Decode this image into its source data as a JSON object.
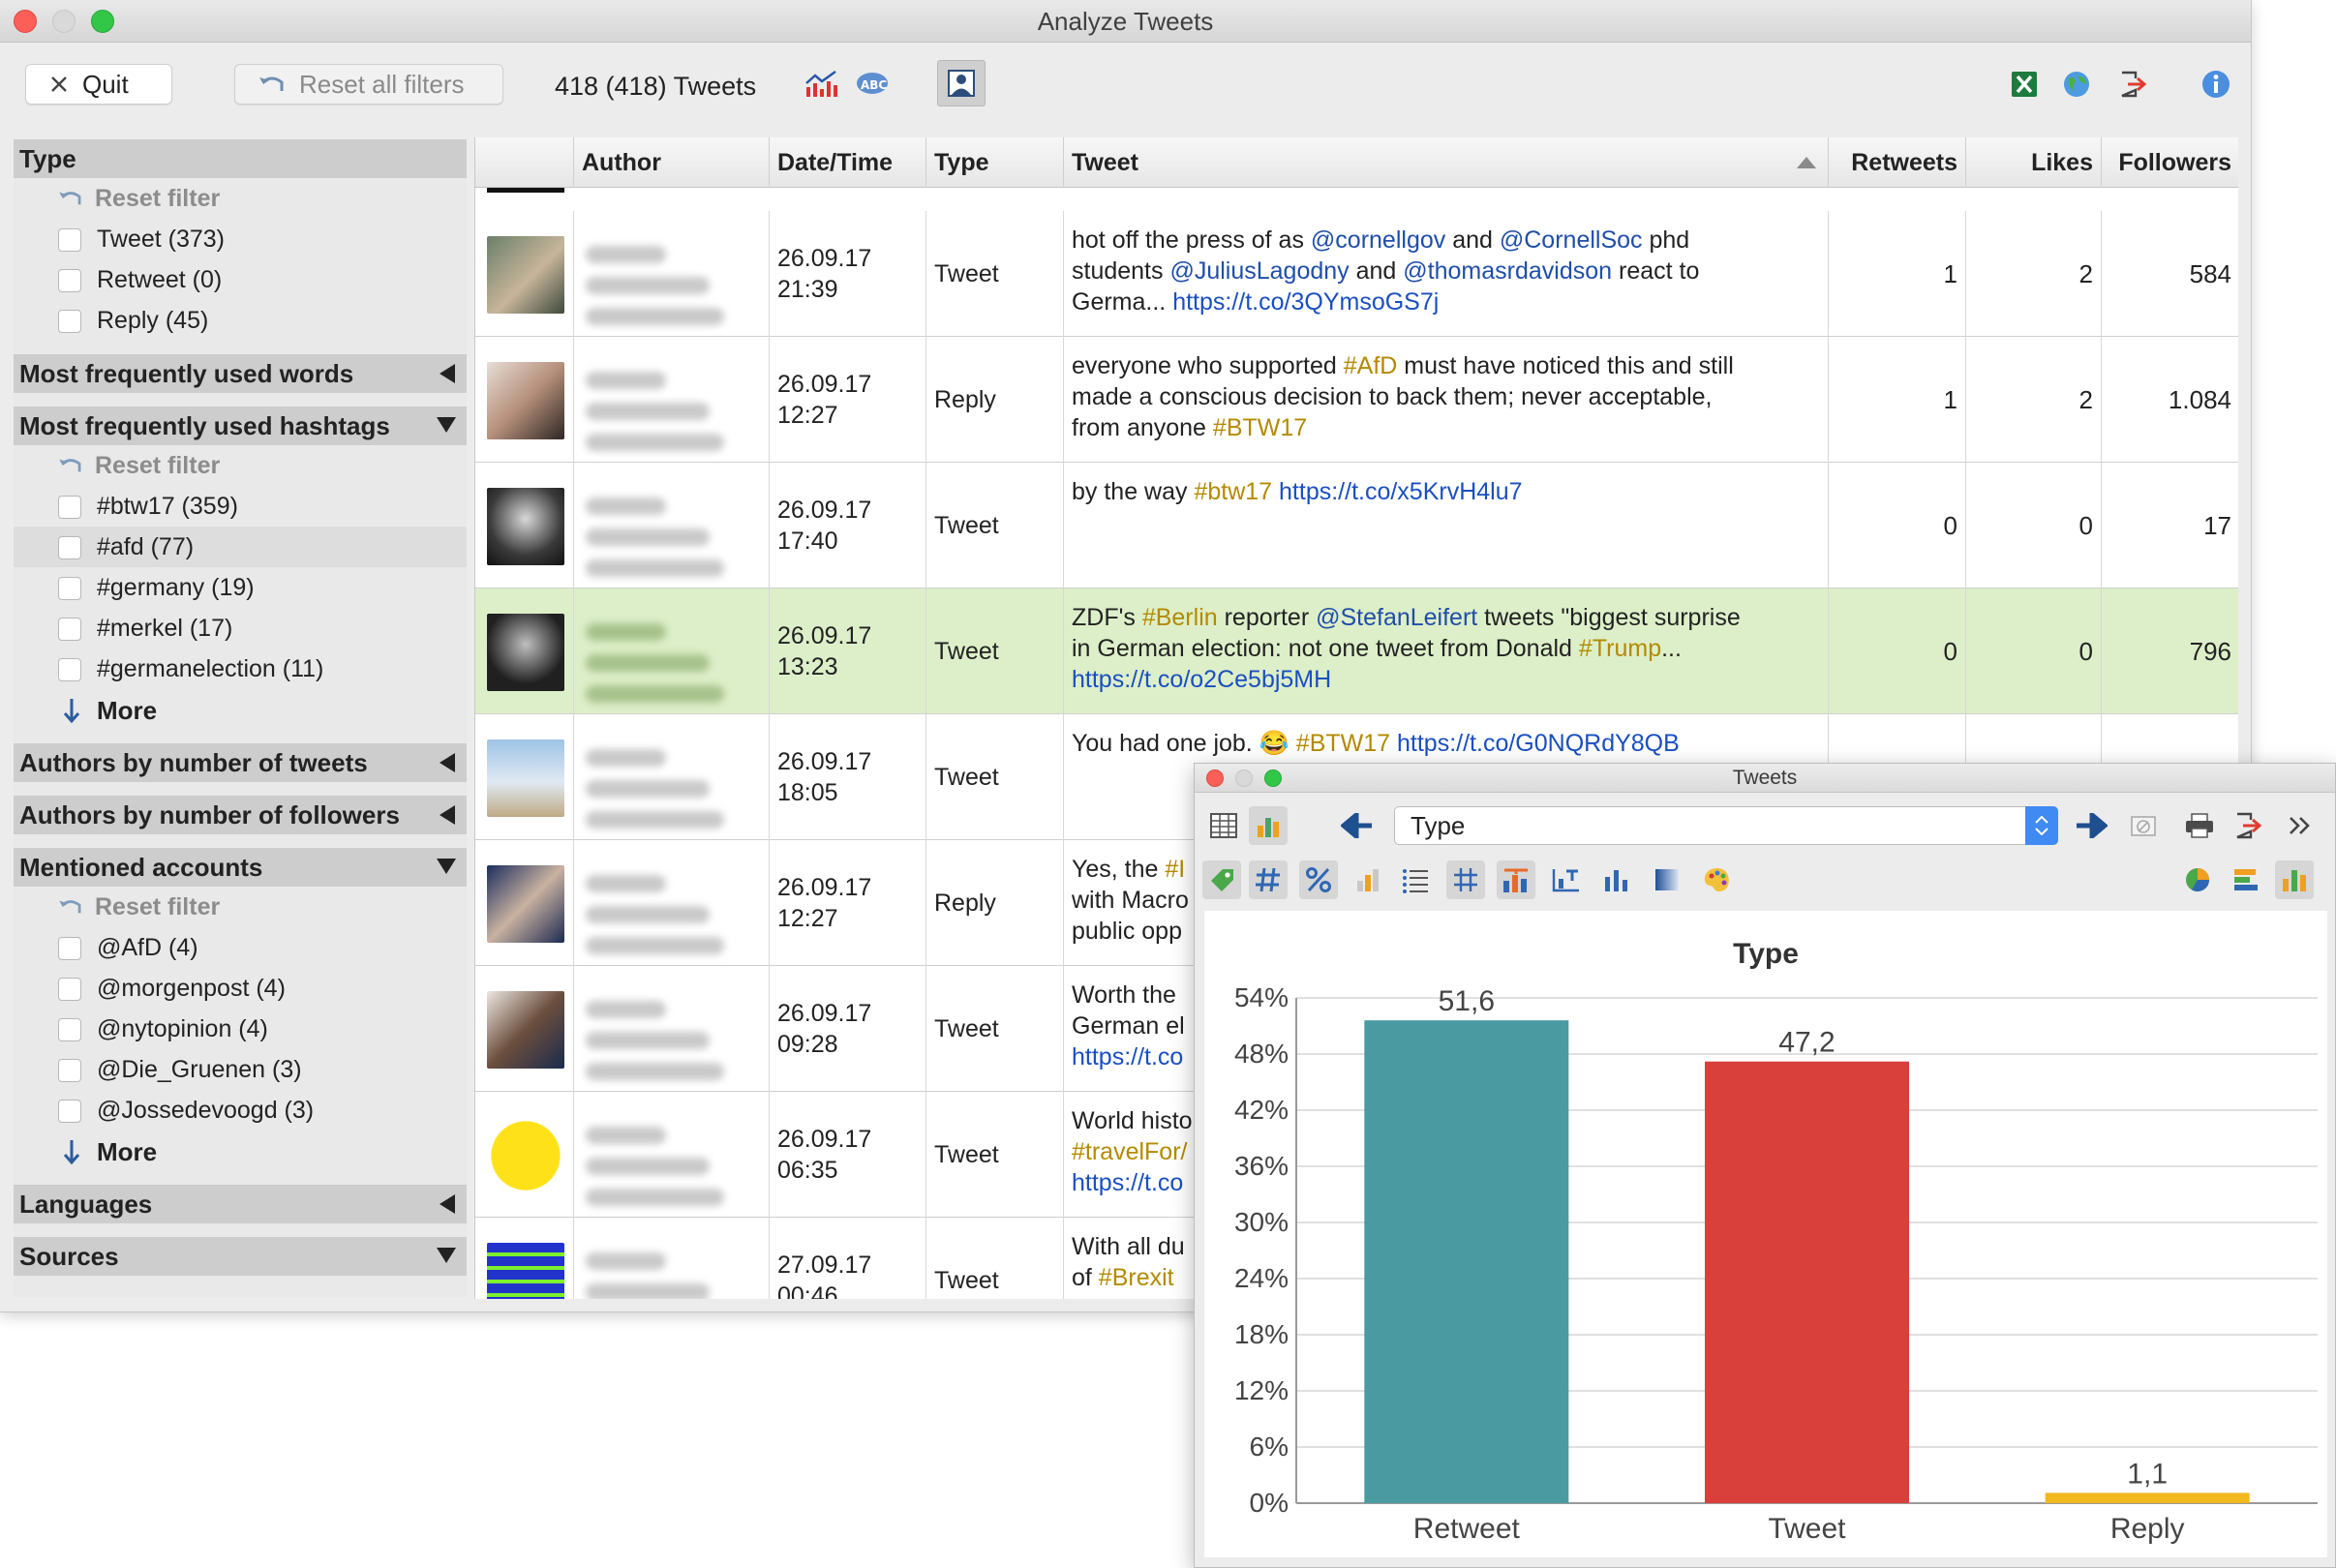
{
  "window": {
    "title": "Analyze Tweets"
  },
  "toolbar": {
    "quit_label": "Quit",
    "reset_label": "Reset all filters",
    "tweet_count": "418 (418) Tweets"
  },
  "sidebar": {
    "type": {
      "header": "Type",
      "reset": "Reset filter",
      "items": [
        "Tweet (373)",
        "Retweet (0)",
        "Reply (45)"
      ]
    },
    "words": {
      "header": "Most frequently used words"
    },
    "hashtags": {
      "header": "Most frequently used hashtags",
      "reset": "Reset filter",
      "items": [
        "#btw17 (359)",
        "#afd (77)",
        "#germany (19)",
        "#merkel (17)",
        "#germanelection (11)"
      ],
      "more": "More"
    },
    "authors_tweets": {
      "header": "Authors by number of tweets"
    },
    "authors_followers": {
      "header": "Authors by number of followers"
    },
    "mentions": {
      "header": "Mentioned accounts",
      "reset": "Reset filter",
      "items": [
        "@AfD (4)",
        "@morgenpost (4)",
        "@nytopinion (4)",
        "@Die_Gruenen (3)",
        "@Jossedevoogd (3)"
      ],
      "more": "More"
    },
    "languages": {
      "header": "Languages"
    },
    "sources": {
      "header": "Sources"
    }
  },
  "table": {
    "headers": {
      "author": "Author",
      "datetime": "Date/Time",
      "type": "Type",
      "tweet": "Tweet",
      "retweets": "Retweets",
      "likes": "Likes",
      "followers": "Followers"
    },
    "rows": [
      {
        "date": "26.09.17",
        "time": "21:39",
        "type": "Tweet",
        "l1": [
          "hot off the press of as ",
          "@cornellgov",
          " and ",
          "@CornellSoc",
          " phd"
        ],
        "l2": [
          "students ",
          "@JuliusLagodny",
          " and ",
          "@thomasrdavidson",
          " react to"
        ],
        "l3": [
          "Germa... ",
          "https://t.co/3QYmsoGS7j"
        ],
        "retweets": "1",
        "likes": "2",
        "followers": "584"
      },
      {
        "date": "26.09.17",
        "time": "12:27",
        "type": "Reply",
        "l1": [
          "everyone who supported ",
          "#AfD",
          " must have noticed this and still"
        ],
        "l2": [
          "made a conscious decision to back them; never acceptable,"
        ],
        "l3": [
          "from anyone ",
          "#BTW17"
        ],
        "retweets": "1",
        "likes": "2",
        "followers": "1.084"
      },
      {
        "date": "26.09.17",
        "time": "17:40",
        "type": "Tweet",
        "l1": [
          "by the way ",
          "#btw17",
          " ",
          "https://t.co/x5KrvH4lu7"
        ],
        "retweets": "0",
        "likes": "0",
        "followers": "17"
      },
      {
        "date": "26.09.17",
        "time": "13:23",
        "type": "Tweet",
        "l1": [
          "ZDF's ",
          "#Berlin",
          " reporter ",
          "@StefanLeifert",
          " tweets \"biggest surprise"
        ],
        "l2": [
          "in German election: not one tweet from Donald ",
          "#Trump",
          "..."
        ],
        "l3": [
          "https://t.co/o2Ce5bj5MH"
        ],
        "retweets": "0",
        "likes": "0",
        "followers": "796"
      },
      {
        "date": "26.09.17",
        "time": "18:05",
        "type": "Tweet",
        "l1": [
          "You had one job. ",
          "😂",
          " ",
          "#BTW17",
          " ",
          "https://t.co/G0NQRdY8QB"
        ]
      },
      {
        "date": "26.09.17",
        "time": "12:27",
        "type": "Reply",
        "l1": [
          "Yes, the ",
          "#I"
        ],
        "l2": [
          "with Macro"
        ],
        "l3": [
          "public opp"
        ]
      },
      {
        "date": "26.09.17",
        "time": "09:28",
        "type": "Tweet",
        "l1": [
          "Worth the"
        ],
        "l2": [
          "German el"
        ],
        "l3": [
          "https://t.co"
        ]
      },
      {
        "date": "26.09.17",
        "time": "06:35",
        "type": "Tweet",
        "l1": [
          "World histo"
        ],
        "l2": [
          "#travelFor/"
        ],
        "l3": [
          "https://t.co"
        ]
      },
      {
        "date": "27.09.17",
        "time": "00:46",
        "type": "Tweet",
        "l1": [
          "With all du"
        ],
        "l2": [
          "of ",
          "#Brexit"
        ]
      }
    ]
  },
  "chart_window": {
    "title": "Tweets",
    "variable": "Type"
  },
  "chart_data": {
    "type": "bar",
    "title": "Type",
    "categories": [
      "Retweet",
      "Tweet",
      "Reply"
    ],
    "values": [
      51.6,
      47.2,
      1.1
    ],
    "value_labels": [
      "51,6",
      "47,2",
      "1,1"
    ],
    "colors": [
      "#4a9aa2",
      "#d9403c",
      "#f2b81f"
    ],
    "ylim": [
      0,
      54
    ],
    "yticks": [
      "0%",
      "6%",
      "12%",
      "18%",
      "24%",
      "30%",
      "36%",
      "42%",
      "48%",
      "54%"
    ],
    "grid": true,
    "legend": "none"
  }
}
